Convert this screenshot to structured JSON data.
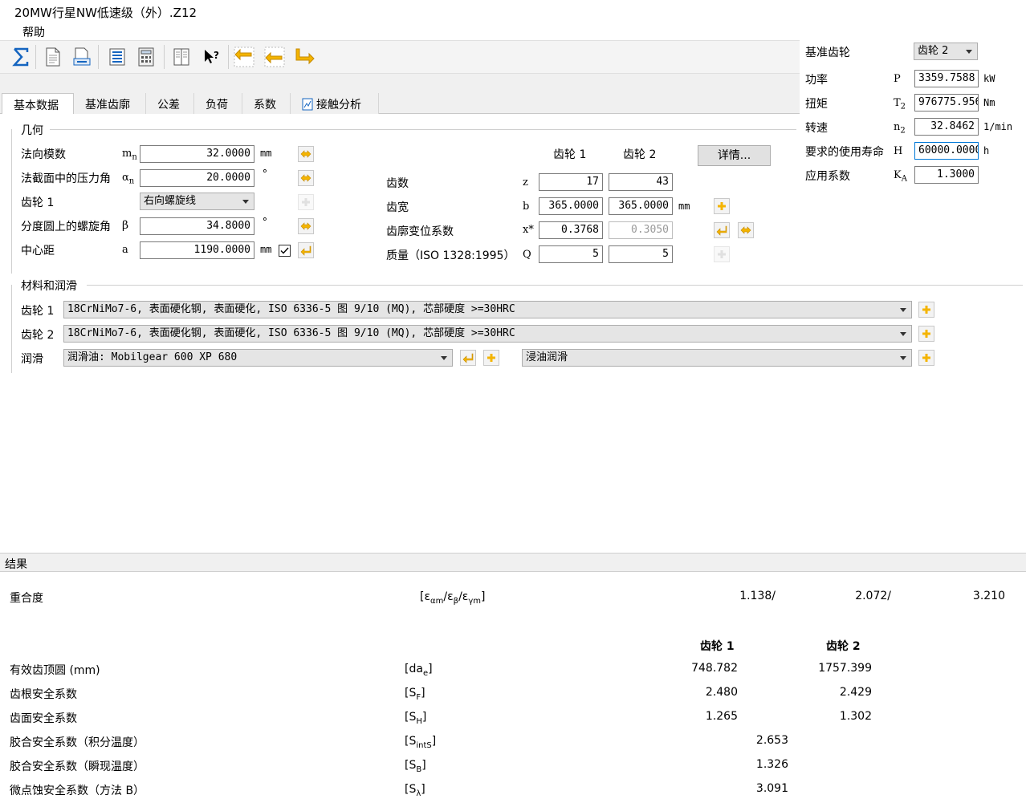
{
  "window": {
    "title": "20MW行星NW低速级（外）.Z12"
  },
  "menu": {
    "items": [
      "帮助"
    ]
  },
  "toolbar": {
    "buttons": [
      "sigma-icon",
      "document-icon",
      "print-preview-icon",
      "report-list-icon",
      "calculator-icon",
      "book-icon",
      "help-cursor-icon",
      "sizing-arrow-1-icon",
      "sizing-arrow-2-icon",
      "sizing-arrow-3-icon"
    ]
  },
  "tabs": [
    "基本数据",
    "基准齿廓",
    "公差",
    "负荷",
    "系数",
    "接触分析"
  ],
  "geometry": {
    "title": "几何",
    "normal_module": {
      "label": "法向模数",
      "symbol": "mn",
      "value": "32.0000",
      "unit": "mm"
    },
    "pressure_angle": {
      "label": "法截面中的压力角",
      "symbol": "αn",
      "value": "20.0000",
      "unit": "°"
    },
    "gear1_helix": {
      "label": "齿轮 1",
      "value": "右向螺旋线"
    },
    "helix_angle": {
      "label": "分度圆上的螺旋角",
      "symbol": "β",
      "value": "34.8000",
      "unit": "°"
    },
    "center_distance": {
      "label": "中心距",
      "symbol": "a",
      "value": "1190.0000",
      "unit": "mm"
    },
    "gear_headers": [
      "齿轮 1",
      "齿轮 2"
    ],
    "details_button": "详情...",
    "teeth": {
      "label": "齿数",
      "symbol": "z",
      "v1": "17",
      "v2": "43"
    },
    "face_width": {
      "label": "齿宽",
      "symbol": "b",
      "v1": "365.0000",
      "v2": "365.0000",
      "unit": "mm"
    },
    "profile_shift": {
      "label": "齿廓变位系数",
      "symbol": "x*",
      "v1": "0.3768",
      "v2": "0.3050"
    },
    "quality": {
      "label": "质量（ISO 1328:1995）",
      "symbol": "Q",
      "v1": "5",
      "v2": "5"
    }
  },
  "materials": {
    "title": "材料和润滑",
    "gear1": {
      "label": "齿轮 1",
      "value": "18CrNiMo7-6, 表面硬化钢, 表面硬化, ISO 6336-5 图 9/10 (MQ), 芯部硬度 >=30HRC"
    },
    "gear2": {
      "label": "齿轮 2",
      "value": "18CrNiMo7-6, 表面硬化钢, 表面硬化, ISO 6336-5 图 9/10 (MQ), 芯部硬度 >=30HRC"
    },
    "lubrication": {
      "label": "润滑",
      "oil": "润滑油: Mobilgear 600 XP 680",
      "type": "浸油润滑"
    }
  },
  "side": {
    "reference_gear": {
      "label": "基准齿轮",
      "value": "齿轮 2"
    },
    "power": {
      "label": "功率",
      "symbol": "P",
      "value": "3359.7588",
      "unit": "kW"
    },
    "torque": {
      "label": "扭矩",
      "symbol": "T2",
      "value": "976775.956",
      "unit": "Nm"
    },
    "speed": {
      "label": "转速",
      "symbol": "n2",
      "value": "32.8462",
      "unit": "1/min"
    },
    "life": {
      "label": "要求的使用寿命",
      "symbol": "H",
      "value": "60000.0000",
      "unit": "h"
    },
    "app_factor": {
      "label": "应用系数",
      "symbol": "KA",
      "value": "1.3000"
    }
  },
  "results": {
    "title": "结果",
    "contact_ratio": {
      "label": "重合度",
      "symbol": "[εαm/εβ/εγm]",
      "v1": "1.138/",
      "v2": "2.072/",
      "v3": "3.210"
    },
    "gear_headers": [
      "齿轮 1",
      "齿轮 2"
    ],
    "rows": [
      {
        "label": "有效齿顶圆 (mm)",
        "symbol": "[dae]",
        "v1": "748.782",
        "v2": "1757.399"
      },
      {
        "label": "齿根安全系数",
        "symbol": "[SF]",
        "v1": "2.480",
        "v2": "2.429"
      },
      {
        "label": "齿面安全系数",
        "symbol": "[SH]",
        "v1": "1.265",
        "v2": "1.302"
      }
    ],
    "single_rows": [
      {
        "label": "胶合安全系数（积分温度）",
        "symbol": "[SintS]",
        "value": "2.653"
      },
      {
        "label": "胶合安全系数（瞬现温度）",
        "symbol": "[SB]",
        "value": "1.326"
      },
      {
        "label": "微点蚀安全系数（方法 B）",
        "symbol": "[Sλ]",
        "value": "3.091"
      }
    ]
  }
}
